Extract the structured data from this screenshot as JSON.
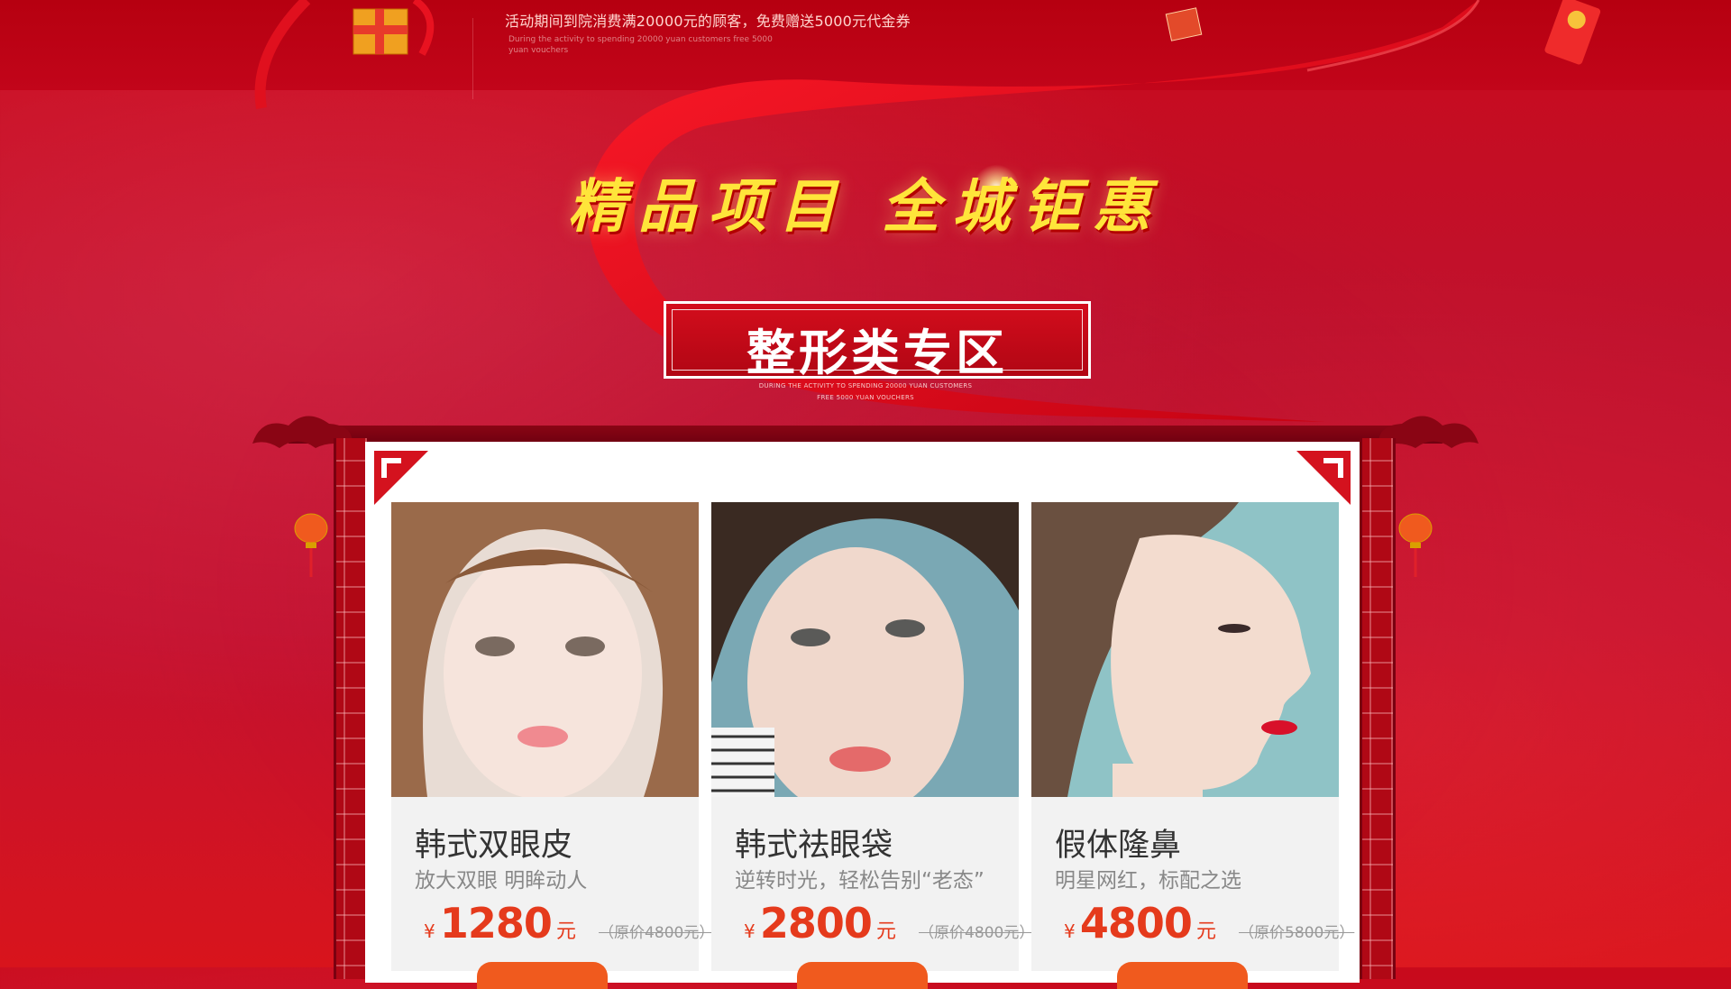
{
  "promo": {
    "text": "活动期间到院消费满20000元的顾客，免费赠送5000元代金券",
    "sub": "During the activity to spending 20000 yuan customers free 5000 yuan vouchers"
  },
  "headline": "精品项目 全城钜惠",
  "section": {
    "title": "整形类专区",
    "sub_line1": "DURING THE ACTIVITY TO SPENDING 20000 YUAN CUSTOMERS",
    "sub_line2": "FREE 5000 YUAN VOUCHERS"
  },
  "products": [
    {
      "title": "韩式双眼皮",
      "desc": "放大双眼 明眸动人",
      "yen": "¥",
      "price": "1280",
      "unit": "元",
      "original": "（原价4800元）"
    },
    {
      "title": "韩式祛眼袋",
      "desc": "逆转时光，轻松告别“老态”",
      "yen": "¥",
      "price": "2800",
      "unit": "元",
      "original": "（原价4800元）"
    },
    {
      "title": "假体隆鼻",
      "desc": "明星网红，标配之选",
      "yen": "¥",
      "price": "4800",
      "unit": "元",
      "original": "（原价5800元）"
    }
  ],
  "colors": {
    "background": "#c41230",
    "headline": "#ffe53a",
    "price": "#e53a1c",
    "button": "#f05a1e"
  },
  "icons": [
    "gift-box-icon",
    "red-envelope-icon",
    "lantern-icon",
    "cloud-ornament-icon"
  ]
}
